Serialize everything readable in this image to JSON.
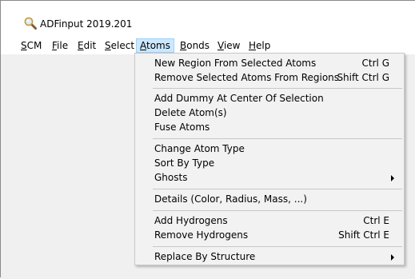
{
  "window": {
    "title": "ADFinput 2019.201"
  },
  "menubar": {
    "items": [
      {
        "label": "SCM",
        "mnemonic": "S",
        "rest": "CM"
      },
      {
        "label": "File",
        "mnemonic": "F",
        "rest": "ile"
      },
      {
        "label": "Edit",
        "mnemonic": "E",
        "rest": "dit"
      },
      {
        "label": "Select",
        "mnemonic": "S",
        "rest": "elect"
      },
      {
        "label": "Atoms",
        "mnemonic": "A",
        "rest": "toms"
      },
      {
        "label": "Bonds",
        "mnemonic": "B",
        "rest": "onds"
      },
      {
        "label": "View",
        "mnemonic": "V",
        "rest": "iew"
      },
      {
        "label": "Help",
        "mnemonic": "H",
        "rest": "elp"
      }
    ],
    "active": "Atoms"
  },
  "atoms_menu": {
    "items": [
      {
        "label": "New Region From Selected Atoms",
        "shortcut": "Ctrl G"
      },
      {
        "label": "Remove Selected Atoms From Regions",
        "shortcut": "Shift Ctrl G"
      },
      {
        "label": "Add Dummy At Center Of Selection",
        "shortcut": ""
      },
      {
        "label": "Delete Atom(s)",
        "shortcut": ""
      },
      {
        "label": "Fuse Atoms",
        "shortcut": ""
      },
      {
        "label": "Change Atom Type",
        "shortcut": ""
      },
      {
        "label": "Sort By Type",
        "shortcut": ""
      },
      {
        "label": "Ghosts",
        "shortcut": ""
      },
      {
        "label": "Details (Color, Radius, Mass, ...)",
        "shortcut": ""
      },
      {
        "label": "Add Hydrogens",
        "shortcut": "Ctrl E"
      },
      {
        "label": "Remove Hydrogens",
        "shortcut": "Shift Ctrl E"
      },
      {
        "label": "Replace By Structure",
        "shortcut": ""
      }
    ]
  },
  "icons": {
    "app": "magnifier-icon",
    "submenu": "submenu-arrow-icon"
  },
  "colors": {
    "menu_highlight_bg": "#cce8ff",
    "menu_highlight_border": "#99d1ff",
    "menu_bg": "#f2f2f2",
    "titlebar_bg": "#ffffff"
  }
}
